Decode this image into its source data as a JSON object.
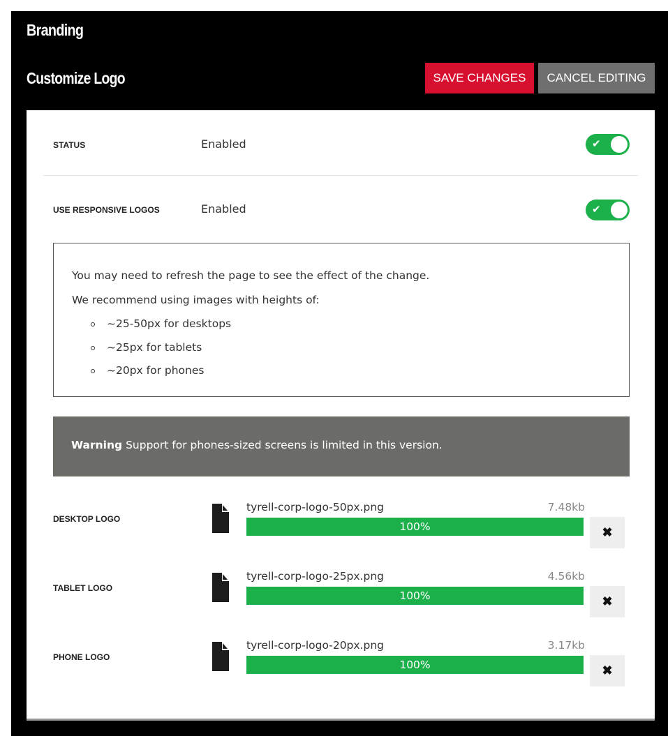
{
  "header": {
    "title": "Branding",
    "section_title": "Customize Logo",
    "save_label": "SAVE CHANGES",
    "cancel_label": "CANCEL EDITING"
  },
  "colors": {
    "accent_red": "#d8102f",
    "cancel_gray": "#6f6f6f",
    "toggle_green": "#1bb04a",
    "warning_bg": "#6b6b68"
  },
  "settings": [
    {
      "label": "STATUS",
      "value": "Enabled",
      "enabled": true
    },
    {
      "label": "USE RESPONSIVE LOGOS",
      "value": "Enabled",
      "enabled": true
    }
  ],
  "info": {
    "line1": "You may need to refresh the page to see the effect of the change.",
    "line2": "We recommend using images with heights of:",
    "items": [
      "~25-50px for desktops",
      "~25px for tablets",
      "~20px for phones"
    ]
  },
  "warning": {
    "label": "Warning",
    "text": " Support for phones-sized screens is limited in this version."
  },
  "logos": [
    {
      "label": "DESKTOP LOGO",
      "file": "tyrell-corp-logo-50px.png",
      "size": "7.48kb",
      "progress": 100,
      "progress_text": "100%",
      "icon": "file-icon",
      "remove_icon": "close-icon"
    },
    {
      "label": "TABLET LOGO",
      "file": "tyrell-corp-logo-25px.png",
      "size": "4.56kb",
      "progress": 100,
      "progress_text": "100%",
      "icon": "file-icon",
      "remove_icon": "close-icon"
    },
    {
      "label": "PHONE LOGO",
      "file": "tyrell-corp-logo-20px.png",
      "size": "3.17kb",
      "progress": 100,
      "progress_text": "100%",
      "icon": "file-icon",
      "remove_icon": "close-icon"
    }
  ]
}
